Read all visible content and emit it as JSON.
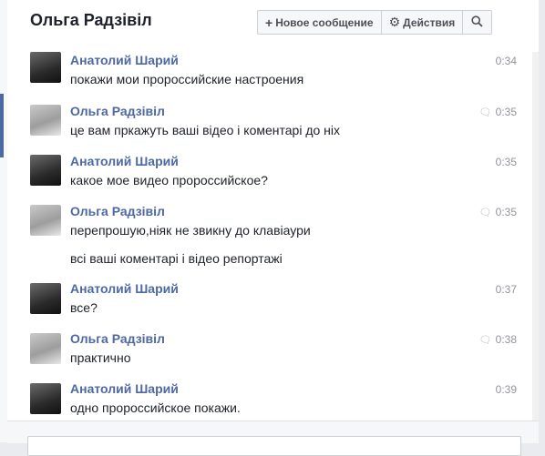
{
  "header": {
    "title": "Ольга Радзівіл",
    "new_message_label": "Новое сообщение",
    "actions_label": "Действия"
  },
  "messages": [
    {
      "sender": "Анатолий Шарий",
      "time": "0:34",
      "text": "покажи мои пророссийские настроения",
      "seen": false
    },
    {
      "sender": "Ольга Радзівіл",
      "time": "0:35",
      "text": "це вам пркажуть ваші відео і коментарі до ніх",
      "seen": true
    },
    {
      "sender": "Анатолий Шарий",
      "time": "0:35",
      "text": "какое мое видео пророссийское?",
      "seen": false
    },
    {
      "sender": "Ольга Радзівіл",
      "time": "0:35",
      "text": "перепрошую,ніяк не звикну до клавіаури",
      "text2": "всі ваші коментарі і відео репортажі",
      "seen": true
    },
    {
      "sender": "Анатолий Шарий",
      "time": "0:37",
      "text": "все?",
      "seen": false
    },
    {
      "sender": "Ольга Радзівіл",
      "time": "0:38",
      "text": "практично",
      "seen": true
    },
    {
      "sender": "Анатолий Шарий",
      "time": "0:39",
      "text": "одно пророссийское покажи.",
      "seen": false
    }
  ],
  "icons": {
    "plus": "plus-icon",
    "gear": "gear-icon",
    "search": "search-icon",
    "seen": "speech-bubble-icon"
  }
}
